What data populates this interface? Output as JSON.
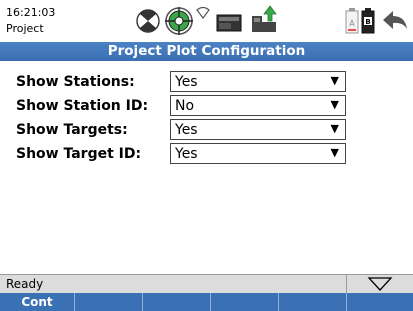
{
  "status_bar_top": {
    "time": "16:21:03",
    "app_name": "Project"
  },
  "header_icons": [
    "measure-mode-icon",
    "gps-target-icon",
    "wireless-signal-icon",
    "data-card-icon",
    "instrument-upload-icon",
    "battery-a-icon",
    "battery-b-icon",
    "back-arrow-icon"
  ],
  "title": "Project Plot Configuration",
  "settings": [
    {
      "label": "Show Stations:",
      "value": "Yes"
    },
    {
      "label": "Show Station ID:",
      "value": "No"
    },
    {
      "label": "Show Targets:",
      "value": "Yes"
    },
    {
      "label": "Show Target ID:",
      "value": "Yes"
    }
  ],
  "status": "Ready",
  "softkeys": [
    "Cont",
    "",
    "",
    "",
    "",
    ""
  ],
  "colors": {
    "title_bar": "#3f73b8",
    "softkey_bar": "#3a70b4",
    "status_bar": "#dcdcdc",
    "gps_green": "#3aa84a"
  }
}
